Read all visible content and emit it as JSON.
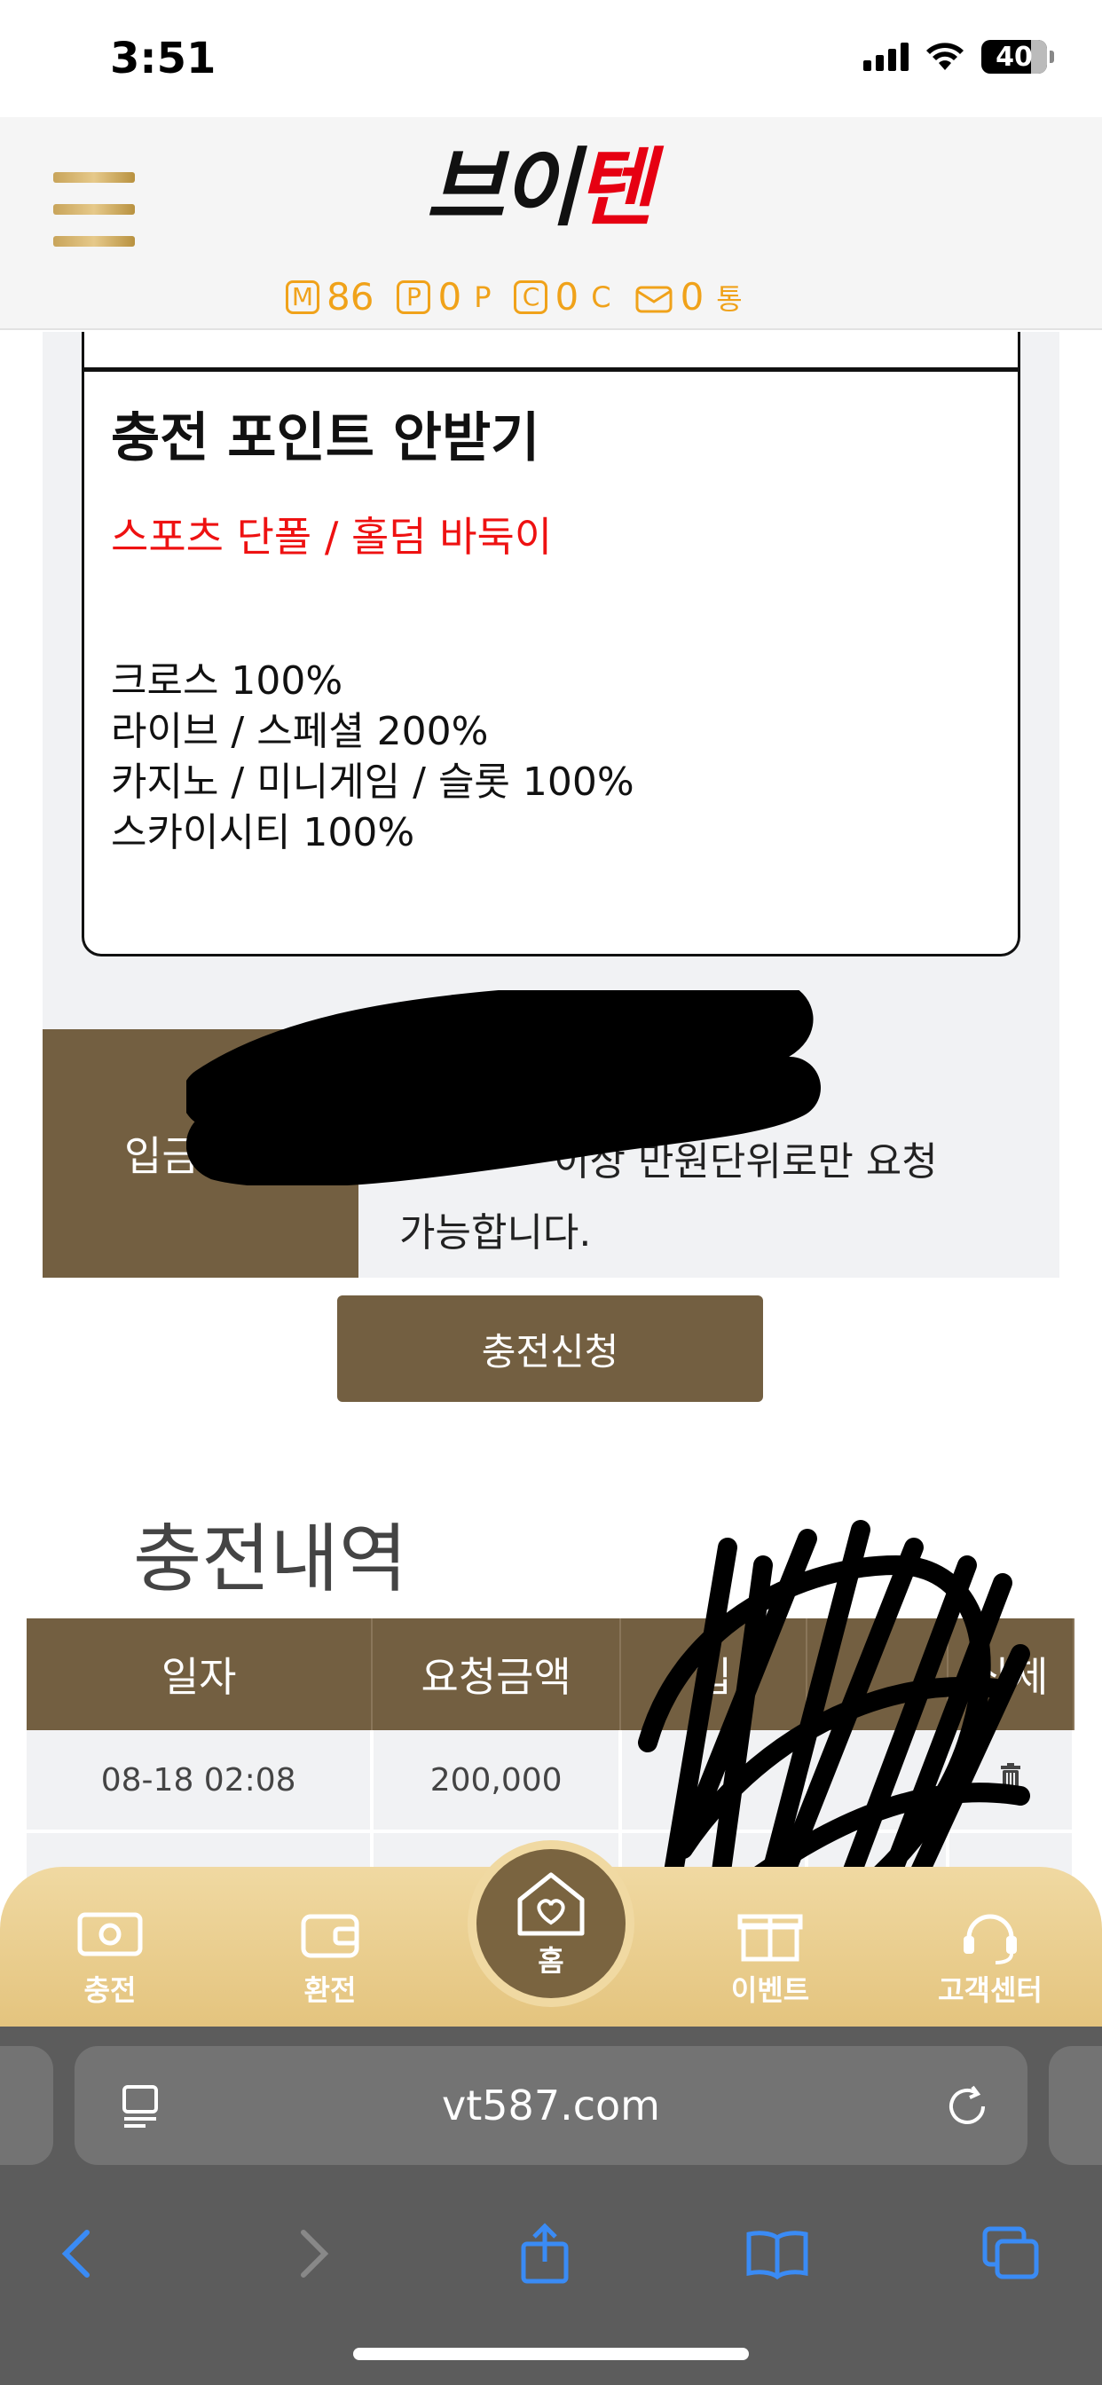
{
  "status_bar": {
    "time": "3:51",
    "battery": "40"
  },
  "header": {
    "logo_part1": "브이",
    "logo_part2": "텐",
    "points": [
      {
        "icon": "M",
        "value": "86",
        "unit": ""
      },
      {
        "icon": "P",
        "value": "0",
        "unit": "P"
      },
      {
        "icon": "C",
        "value": "0",
        "unit": "C"
      },
      {
        "icon": "mail-icon",
        "value": "0",
        "unit": "통"
      }
    ]
  },
  "bonus": {
    "title": "충전 포인트 안받기",
    "red_line": "스포츠 단폴 / 홀덤 바둑이",
    "lines": [
      "크로스 100%",
      "라이브 / 스페셜 200%",
      "카지노 / 미니게임 / 슬롯 100%",
      "스카이시티 100%"
    ]
  },
  "depositor": {
    "label": "입금자",
    "note_line1": "이상 만원단위로만 요청",
    "note_line2": "가능합니다."
  },
  "apply_button": "충전신청",
  "history": {
    "title": "충전내역",
    "columns": [
      "일자",
      "요청금액",
      "입",
      "",
      "삭제"
    ],
    "rows": [
      [
        "08-18 02:08",
        "200,000",
        "",
        "",
        ""
      ]
    ]
  },
  "tab_bar": {
    "items": [
      {
        "label": "충전",
        "icon": "money-icon"
      },
      {
        "label": "환전",
        "icon": "wallet-icon"
      },
      {
        "label": "홈",
        "icon": "home-heart-icon"
      },
      {
        "label": "이벤트",
        "icon": "gift-icon"
      },
      {
        "label": "고객센터",
        "icon": "headset-icon"
      }
    ]
  },
  "browser": {
    "url": "vt587.com"
  }
}
